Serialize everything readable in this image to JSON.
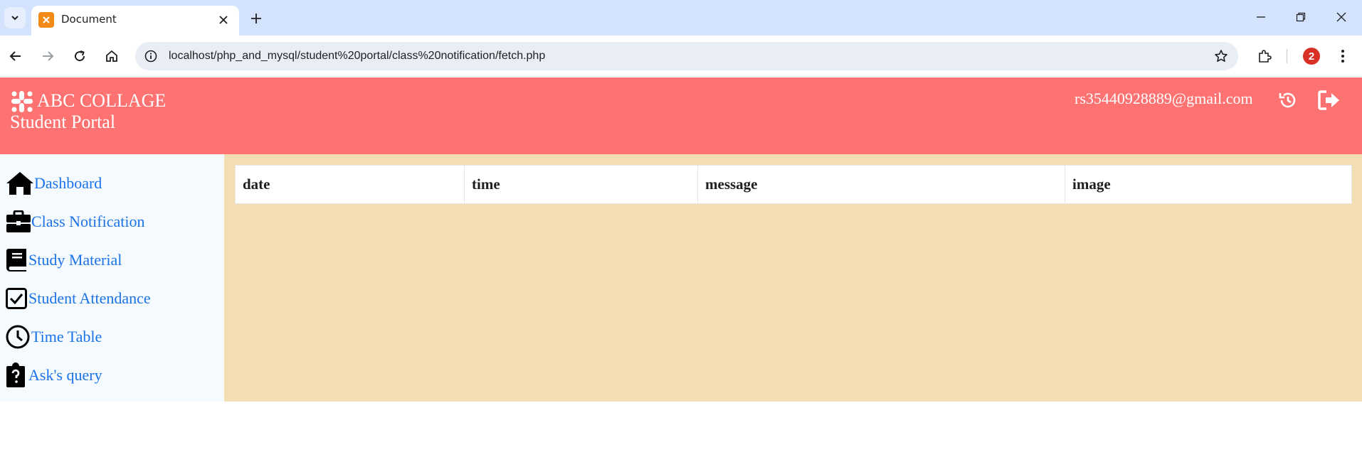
{
  "browser": {
    "tab_title": "Document",
    "url": "localhost/php_and_mysql/student%20portal/class%20notification/fetch.php",
    "profile_badge": "2"
  },
  "header": {
    "brand": "ABC COLLAGE",
    "subtitle": "Student Portal",
    "email": "rs35440928889@gmail.com",
    "color": "#ff7272"
  },
  "sidebar": {
    "items": [
      {
        "label": "Dashboard",
        "icon": "home-icon"
      },
      {
        "label": "Class Notification",
        "icon": "briefcase-icon"
      },
      {
        "label": "Study Material",
        "icon": "book-icon"
      },
      {
        "label": "Student Attendance",
        "icon": "checkbox-icon"
      },
      {
        "label": "Time Table",
        "icon": "clock-icon"
      },
      {
        "label": "Ask's query",
        "icon": "clipboard-question-icon"
      }
    ]
  },
  "table": {
    "columns": [
      "date",
      "time",
      "message",
      "image"
    ]
  },
  "colors": {
    "main_bg": "#f3ddb3",
    "sidebar_bg": "#f5faff",
    "link": "#1a73e8"
  }
}
